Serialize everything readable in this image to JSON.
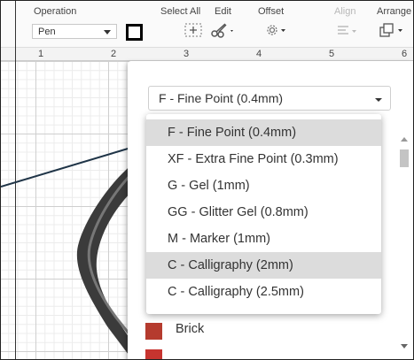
{
  "toolbar": {
    "operation_label": "Operation",
    "operation_value": "Pen",
    "select_all_label": "Select All",
    "edit_label": "Edit",
    "offset_label": "Offset",
    "align_label": "Align",
    "arrange_label": "Arrange"
  },
  "ruler": {
    "marks": [
      "1",
      "2",
      "3",
      "4",
      "5",
      "6"
    ]
  },
  "pen_dropdown": {
    "selected": "F - Fine Point (0.4mm)",
    "options": [
      "F - Fine Point (0.4mm)",
      "XF - Extra Fine Point (0.3mm)",
      "G - Gel (1mm)",
      "GG - Glitter Gel (0.8mm)",
      "M - Marker (1mm)",
      "C - Calligraphy (2mm)",
      "C - Calligraphy (2.5mm)"
    ],
    "highlighted": [
      "F - Fine Point (0.4mm)",
      "C - Calligraphy (2mm)"
    ]
  },
  "colors": [
    {
      "name": "Brick",
      "hex": "#b53b2e"
    },
    {
      "name": "",
      "hex": "#c7342f"
    }
  ],
  "icons": {
    "select_all": "select-all-icon",
    "edit": "scissors-icon",
    "offset": "offset-icon",
    "align": "align-icon",
    "arrange": "arrange-icon"
  }
}
